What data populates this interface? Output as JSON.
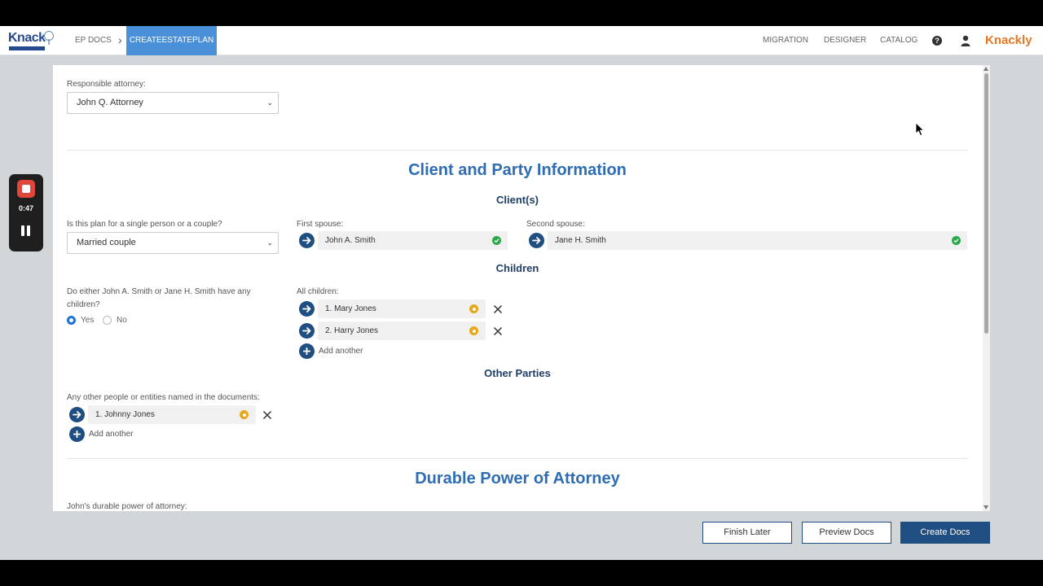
{
  "header": {
    "logo_text": "Knack",
    "breadcrumb": [
      "EP DOCS",
      "CREATEESTATEPLAN"
    ],
    "nav": [
      "MIGRATION",
      "DESIGNER",
      "CATALOG"
    ],
    "brand": "Knackly",
    "icons": [
      "help-icon",
      "user-icon"
    ],
    "accent_color": "#4a90d9",
    "brand_color": "#e87722"
  },
  "form": {
    "responsible_attorney": {
      "label": "Responsible attorney:",
      "value": "John Q. Attorney"
    },
    "client_section": {
      "title": "Client and Party Information",
      "clients_heading": "Client(s)",
      "plan_type": {
        "label": "Is this plan for a single person or a couple?",
        "value": "Married couple"
      },
      "first_spouse": {
        "label": "First spouse:",
        "value": "John A. Smith"
      },
      "second_spouse": {
        "label": "Second spouse:",
        "value": "Jane H. Smith"
      },
      "children_heading": "Children",
      "children_question": {
        "line1": "Do either John A. Smith or Jane H. Smith have any",
        "line2": "children?"
      },
      "yes_label": "Yes",
      "no_label": "No",
      "all_children_label": "All children:",
      "children": [
        "1. Mary Jones",
        "2. Harry Jones"
      ],
      "add_another": "Add another",
      "other_heading": "Other Parties",
      "other_label": "Any other people or entities named in the documents:",
      "other_parties": [
        "1. Johnny Jones"
      ]
    },
    "poa_section": {
      "title": "Durable Power of Attorney",
      "john_poa_label": "John's durable power of attorney:"
    }
  },
  "footer": {
    "finish_later": "Finish Later",
    "preview_docs": "Preview Docs",
    "create_docs": "Create Docs"
  },
  "recorder": {
    "time": "0:47"
  }
}
